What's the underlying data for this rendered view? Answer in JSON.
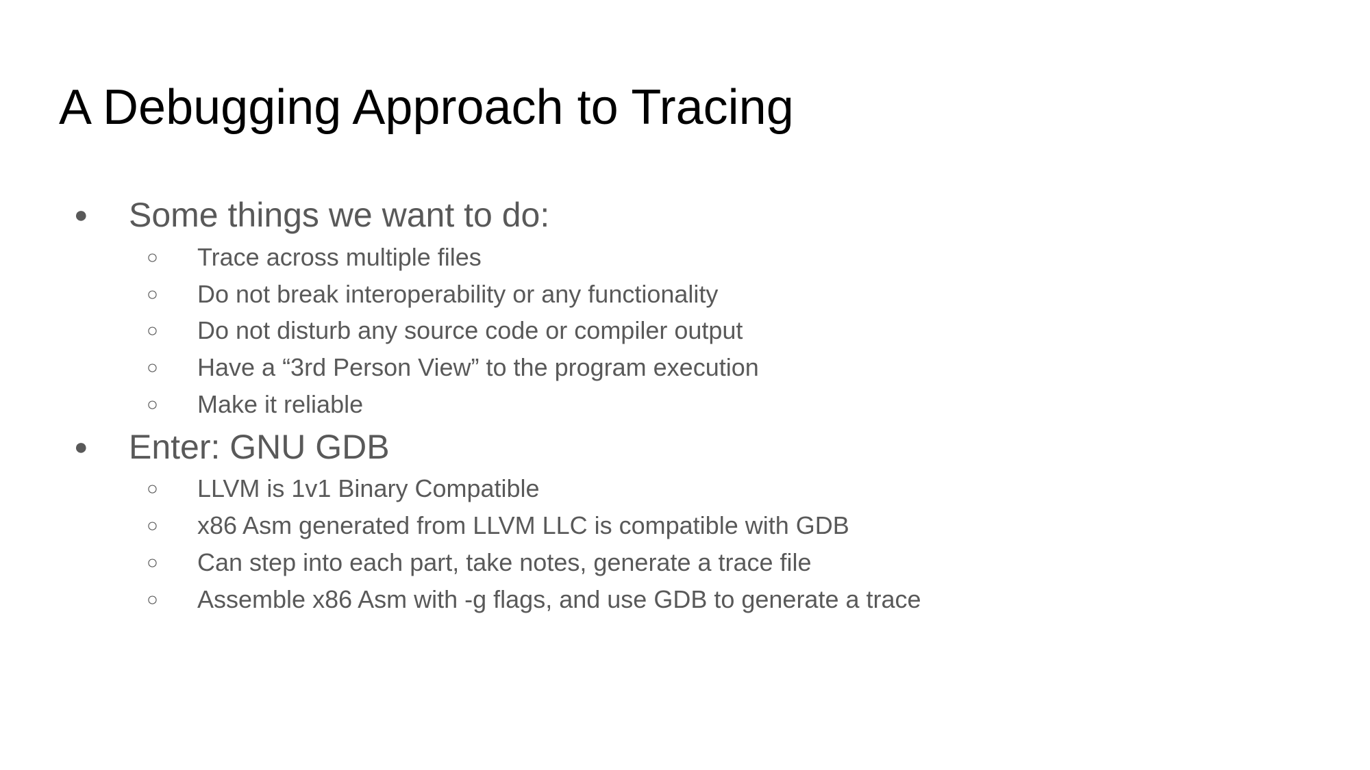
{
  "slide": {
    "title": "A Debugging Approach to Tracing",
    "sections": [
      {
        "text": "Some things we want to do:",
        "items": [
          "Trace across multiple files",
          "Do not break interoperability or any functionality",
          "Do not disturb any source code or compiler output",
          "Have a “3rd Person View” to the program execution",
          "Make it reliable"
        ]
      },
      {
        "text": "Enter: GNU GDB",
        "items": [
          "LLVM is 1v1 Binary Compatible",
          "x86 Asm generated from LLVM LLC is compatible with GDB",
          "Can step into each part, take notes, generate a trace file",
          "Assemble x86 Asm with -g flags, and use GDB to generate a trace"
        ]
      }
    ],
    "bullets": {
      "level1": "●",
      "level2": "○"
    }
  }
}
